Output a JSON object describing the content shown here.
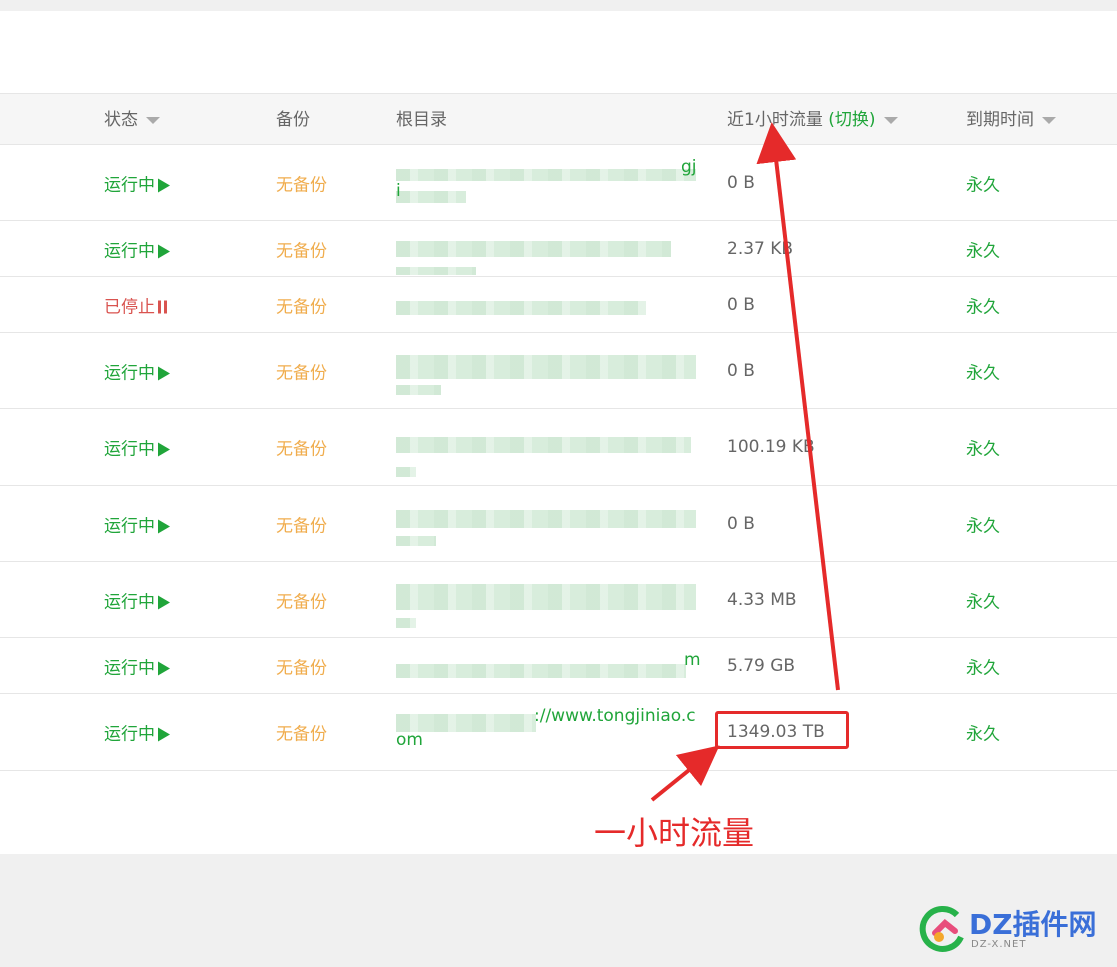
{
  "header": {
    "status": "状态",
    "backup": "备份",
    "root": "根目录",
    "traffic": "近1小时流量",
    "traffic_switch": "(切换)",
    "expire": "到期时间"
  },
  "rows": [
    {
      "status": "运行中",
      "state": "running",
      "backup": "无备份",
      "path_visible": "gji",
      "traffic": "0 B",
      "expire": "永久"
    },
    {
      "status": "运行中",
      "state": "running",
      "backup": "无备份",
      "path_visible": "",
      "traffic": "2.37 KB",
      "expire": "永久"
    },
    {
      "status": "已停止",
      "state": "stopped",
      "backup": "无备份",
      "path_visible": "",
      "traffic": "0 B",
      "expire": "永久"
    },
    {
      "status": "运行中",
      "state": "running",
      "backup": "无备份",
      "path_visible": "",
      "traffic": "0 B",
      "expire": "永久"
    },
    {
      "status": "运行中",
      "state": "running",
      "backup": "无备份",
      "path_visible": "",
      "traffic": "100.19 KB",
      "expire": "永久"
    },
    {
      "status": "运行中",
      "state": "running",
      "backup": "无备份",
      "path_visible": "",
      "traffic": "0 B",
      "expire": "永久"
    },
    {
      "status": "运行中",
      "state": "running",
      "backup": "无备份",
      "path_visible": "",
      "traffic": "4.33 MB",
      "expire": "永久"
    },
    {
      "status": "运行中",
      "state": "running",
      "backup": "无备份",
      "path_visible": "m",
      "traffic": "5.79 GB",
      "expire": "永久"
    },
    {
      "status": "运行中",
      "state": "running",
      "backup": "无备份",
      "path_visible": "://www.tongjiniao.com",
      "traffic": "1349.03 TB",
      "expire": "永久"
    }
  ],
  "annotation": {
    "label": "一小时流量",
    "color": "#e52a2a"
  },
  "watermark": {
    "text": "DZ插件网",
    "sub": "DZ-X.NET"
  },
  "colors": {
    "green": "#20a53a",
    "red": "#d9534f",
    "orange": "#f0ad4e"
  }
}
